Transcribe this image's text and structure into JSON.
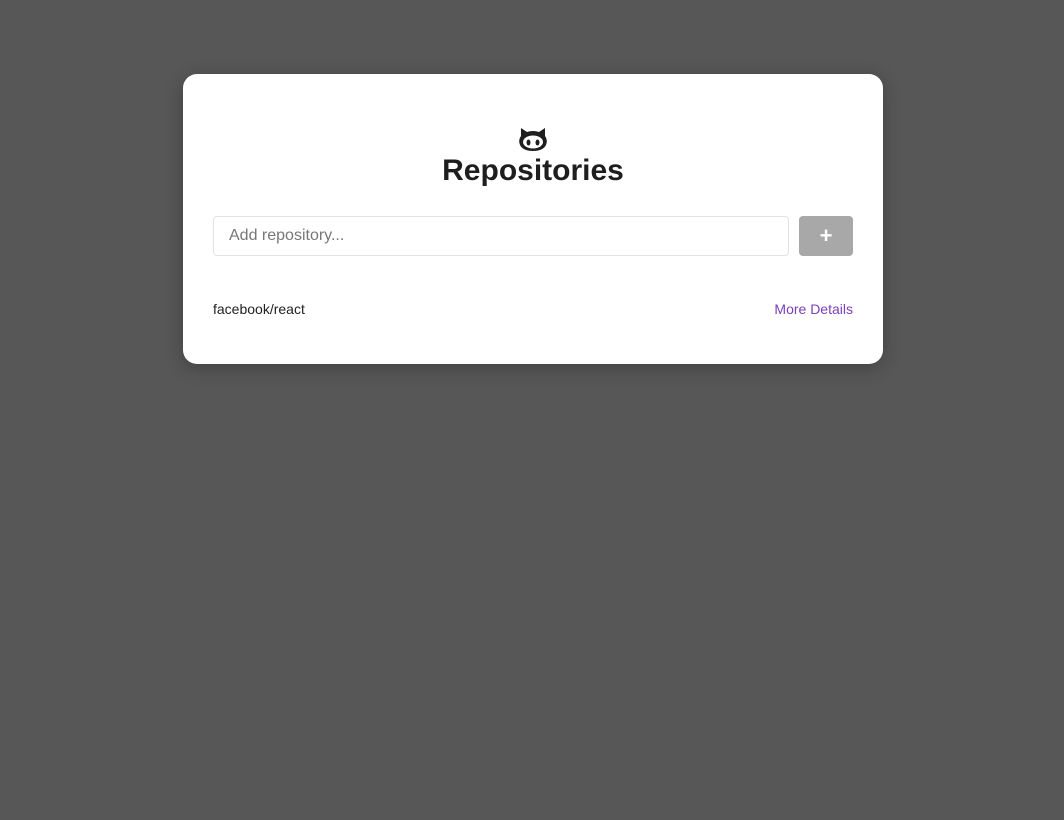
{
  "header": {
    "logo_icon": "github-octocat-icon",
    "title": "Repositories"
  },
  "form": {
    "input_placeholder": "Add repository...",
    "input_value": "",
    "add_button_label": "+"
  },
  "repositories": [
    {
      "name": "facebook/react",
      "link_label": "More Details"
    }
  ],
  "colors": {
    "background": "#575757",
    "card": "#ffffff",
    "button": "#a8a8a8",
    "link": "#7b3fb8"
  }
}
